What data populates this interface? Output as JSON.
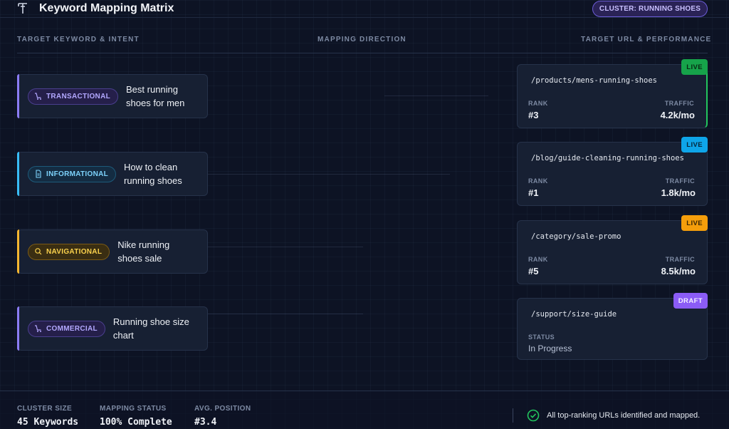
{
  "header": {
    "title": "Keyword Mapping Matrix",
    "cluster_badge": "CLUSTER: RUNNING SHOES"
  },
  "columns": {
    "left": "TARGET KEYWORD & INTENT",
    "middle": "MAPPING DIRECTION",
    "right": "TARGET URL & PERFORMANCE"
  },
  "keywords": [
    {
      "intent": "TRANSACTIONAL",
      "keyword": "Best running shoes for men",
      "icon": "cart-icon",
      "color": "#8b7cf6"
    },
    {
      "intent": "INFORMATIONAL",
      "keyword": "How to clean running shoes",
      "icon": "document-icon",
      "color": "#38bdf8"
    },
    {
      "intent": "NAVIGATIONAL",
      "keyword": "Nike running shoes sale",
      "icon": "search-icon",
      "color": "#f5b630"
    },
    {
      "intent": "COMMERCIAL",
      "keyword": "Running shoe size chart",
      "icon": "cart-icon",
      "color": "#8b7cf6"
    }
  ],
  "urls": [
    {
      "path": "/products/mens-running-shoes",
      "badge": "LIVE",
      "badge_color": "#22c55e",
      "rank_label": "RANK",
      "rank": "#3",
      "traffic_label": "TRAFFIC",
      "traffic": "4.2k/mo"
    },
    {
      "path": "/blog/guide-cleaning-running-shoes",
      "badge": "LIVE",
      "badge_color": "#0ea5e9",
      "rank_label": "RANK",
      "rank": "#1",
      "traffic_label": "TRAFFIC",
      "traffic": "1.8k/mo"
    },
    {
      "path": "/category/sale-promo",
      "badge": "LIVE",
      "badge_color": "#f59e0b",
      "rank_label": "RANK",
      "rank": "#5",
      "traffic_label": "TRAFFIC",
      "traffic": "8.5k/mo"
    },
    {
      "path": "/support/size-guide",
      "badge": "DRAFT",
      "badge_color": "#8b5cf6",
      "status_label": "STATUS",
      "status": "In Progress"
    }
  ],
  "footer": {
    "cluster_size_label": "CLUSTER SIZE",
    "cluster_size": "45 Keywords",
    "mapping_status_label": "MAPPING STATUS",
    "mapping_status": "100% Complete",
    "avg_position_label": "AVG. POSITION",
    "avg_position": "#3.4",
    "message": "All top-ranking URLs identified and mapped.",
    "message_icon": "check-circle-icon"
  }
}
